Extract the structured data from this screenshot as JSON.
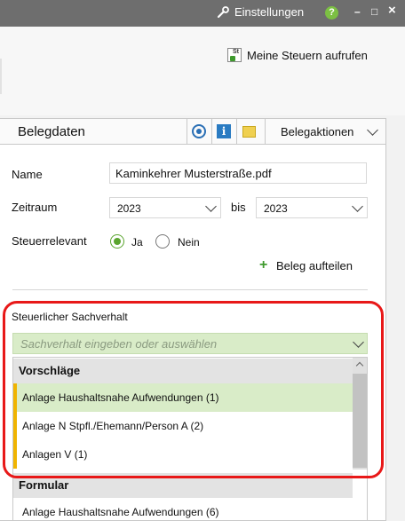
{
  "titlebar": {
    "settings_label": "Einstellungen",
    "help_label": "?",
    "minimize_label": "–",
    "maximize_label": "□",
    "close_label": "×"
  },
  "toolbar": {
    "meine_steuern_label": "Meine Steuern aufrufen",
    "meine_steuern_icon_text": "St"
  },
  "panel": {
    "title": "Belegdaten",
    "info_icon_text": "i",
    "actions_label": "Belegaktionen"
  },
  "form": {
    "name_label": "Name",
    "name_value": "Kaminkehrer Musterstraße.pdf",
    "zeitraum_label": "Zeitraum",
    "zeitraum_from": "2023",
    "bis_label": "bis",
    "zeitraum_to": "2023",
    "steuerrelevant_label": "Steuerrelevant",
    "ja_label": "Ja",
    "nein_label": "Nein",
    "steuerrelevant_value": "Ja",
    "aufteilen_label": "Beleg aufteilen",
    "aufteilen_icon": "+"
  },
  "sachverhalt": {
    "label": "Steuerlicher Sachverhalt",
    "placeholder": "Sachverhalt eingeben oder auswählen",
    "groups": [
      {
        "name": "Vorschläge",
        "options": [
          {
            "label": "Anlage Haushaltsnahe Aufwendungen (1)",
            "selected": true
          },
          {
            "label": "Anlage N Stpfl./Ehemann/Person A (2)",
            "selected": false
          },
          {
            "label": "Anlagen V (1)",
            "selected": false
          }
        ]
      },
      {
        "name": "Formular",
        "options": [
          {
            "label": "Anlage Haushaltsnahe Aufwendungen (6)",
            "selected": false
          }
        ]
      }
    ]
  },
  "colors": {
    "accent_green": "#5aa42e",
    "selection_green": "#d9ecc8",
    "suggestion_bar": "#f0b400",
    "highlight_red": "#e81818"
  }
}
